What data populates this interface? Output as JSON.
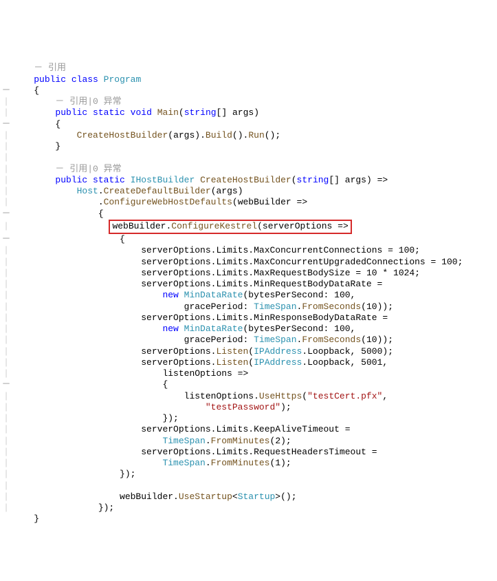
{
  "codelens": {
    "ref_class": "引用",
    "ref_main": "引用|0 异常",
    "ref_chb": "引用|0 异常"
  },
  "collapse": "－",
  "kw": {
    "public": "public",
    "class": "class",
    "static": "static",
    "void": "void",
    "string": "string",
    "new": "new"
  },
  "types": {
    "Program": "Program",
    "IHostBuilder": "IHostBuilder",
    "Host": "Host",
    "MinDataRate": "MinDataRate",
    "TimeSpan": "TimeSpan",
    "IPAddress": "IPAddress",
    "Startup": "Startup"
  },
  "methods": {
    "Main": "Main",
    "CreateHostBuilder": "CreateHostBuilder",
    "Build": "Build",
    "Run": "Run",
    "CreateDefaultBuilder": "CreateDefaultBuilder",
    "ConfigureWebHostDefaults": "ConfigureWebHostDefaults",
    "ConfigureKestrel": "ConfigureKestrel",
    "FromSeconds": "FromSeconds",
    "Listen": "Listen",
    "UseHttps": "UseHttps",
    "FromMinutes": "FromMinutes",
    "UseStartup": "UseStartup"
  },
  "idents": {
    "args": "args",
    "webBuilder": "webBuilder",
    "serverOptions": "serverOptions",
    "Limits": "Limits",
    "MaxConcurrentConnections": "MaxConcurrentConnections",
    "MaxConcurrentUpgradedConnections": "MaxConcurrentUpgradedConnections",
    "MaxRequestBodySize": "MaxRequestBodySize",
    "MinRequestBodyDataRate": "MinRequestBodyDataRate",
    "bytesPerSecond": "bytesPerSecond",
    "gracePeriod": "gracePeriod",
    "MinResponseBodyDataRate": "MinResponseBodyDataRate",
    "Loopback": "Loopback",
    "listenOptions": "listenOptions",
    "KeepAliveTimeout": "KeepAliveTimeout",
    "RequestHeadersTimeout": "RequestHeadersTimeout"
  },
  "nums": {
    "n100": "100",
    "n10": "10",
    "n1024": "1024",
    "n5000": "5000",
    "n5001": "5001",
    "n2": "2",
    "n1": "1"
  },
  "strs": {
    "cert": "\"testCert.pfx\"",
    "pwd": "\"testPassword\""
  },
  "punct": {
    "obrace": "{",
    "cbrace": "}",
    "oparen": "(",
    "cparen": ")",
    "obrack": "[]",
    "semi": ";",
    "comma": ",",
    "dot": ".",
    "eq": "=",
    "arrow": "=>",
    "star": "*",
    "colon": ":",
    "lt": "<",
    "gt": ">",
    "cparensemi": ");",
    "cbrparensemi": "});"
  }
}
